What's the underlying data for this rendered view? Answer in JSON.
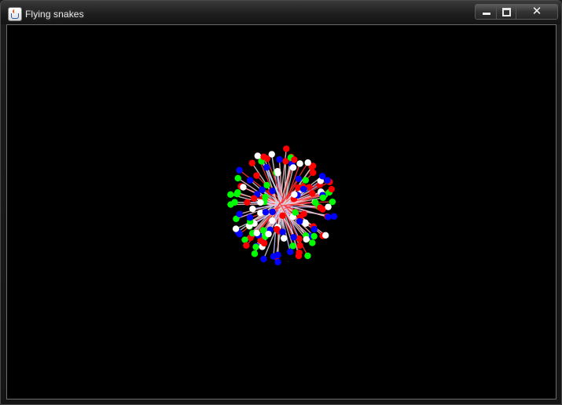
{
  "window": {
    "title": "Flying snakes",
    "icon": "java-cup-icon",
    "close_symbol": "✕"
  },
  "canvas": {
    "background": "#000000",
    "snake_colors": [
      "#ff0000",
      "#00ff00",
      "#0000ff",
      "#ffffff"
    ],
    "link_colors": [
      "#ffc0cb",
      "#d8d8d8",
      "#ff3333",
      "#c0c0ff"
    ]
  }
}
